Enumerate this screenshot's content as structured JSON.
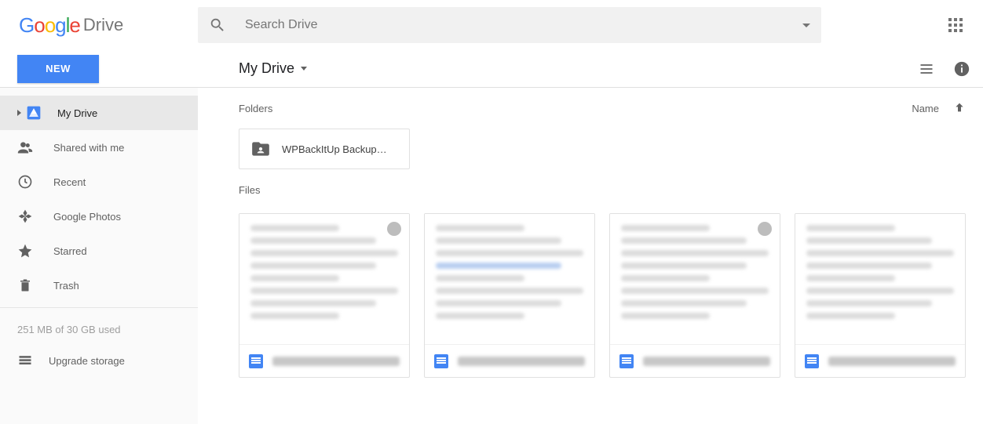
{
  "header": {
    "product": "Drive",
    "search_placeholder": "Search Drive"
  },
  "toolbar": {
    "new_label": "NEW",
    "breadcrumb": "My Drive"
  },
  "sidebar": {
    "items": [
      {
        "label": "My Drive",
        "icon": "drive-icon",
        "active": true
      },
      {
        "label": "Shared with me",
        "icon": "people-icon",
        "active": false
      },
      {
        "label": "Recent",
        "icon": "clock-icon",
        "active": false
      },
      {
        "label": "Google Photos",
        "icon": "photos-icon",
        "active": false
      },
      {
        "label": "Starred",
        "icon": "star-icon",
        "active": false
      },
      {
        "label": "Trash",
        "icon": "trash-icon",
        "active": false
      }
    ],
    "storage": "251 MB of 30 GB used",
    "upgrade": "Upgrade storage"
  },
  "main": {
    "folders_label": "Folders",
    "files_label": "Files",
    "sort_label": "Name",
    "folders": [
      {
        "name": "WPBackItUp Backup…"
      }
    ],
    "files": [
      {
        "title": ""
      },
      {
        "title": ""
      },
      {
        "title": ""
      },
      {
        "title": ""
      }
    ]
  }
}
